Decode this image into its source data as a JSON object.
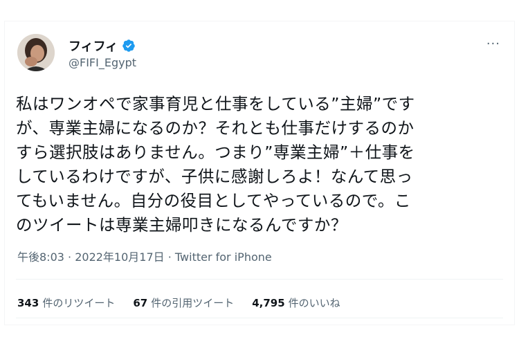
{
  "user": {
    "display_name": "フィフィ",
    "handle": "@FIFI_Egypt",
    "verified_icon": "verified-badge-icon",
    "avatar_icon": "avatar-photo"
  },
  "menu": {
    "more_icon": "more-icon",
    "more_label": "···"
  },
  "tweet": {
    "text": "私はワンオペで家事育児と仕事をしている”主婦”です\nが、専業主婦になるのか？それとも仕事だけするのか\nすら選択肢はありません。つまり”専業主婦”＋仕事を\nしているわけですが、子供に感謝しろよ！なんて思っ\nてもいません。自分の役目としてやっているので。こ\nのツイートは専業主婦叩きになるんですか？"
  },
  "meta": {
    "time": "午後8:03",
    "sep1": " · ",
    "date": "2022年10月17日",
    "sep2": " · ",
    "source": "Twitter for iPhone"
  },
  "stats": {
    "retweets_count": "343",
    "retweets_label": "件のリツイート",
    "quotes_count": "67",
    "quotes_label": "件の引用ツイート",
    "likes_count": "4,795",
    "likes_label": "件のいいね"
  },
  "colors": {
    "text": "#0f1419",
    "secondary": "#536471",
    "verified": "#1d9bf0",
    "divider": "#eff3f4"
  }
}
